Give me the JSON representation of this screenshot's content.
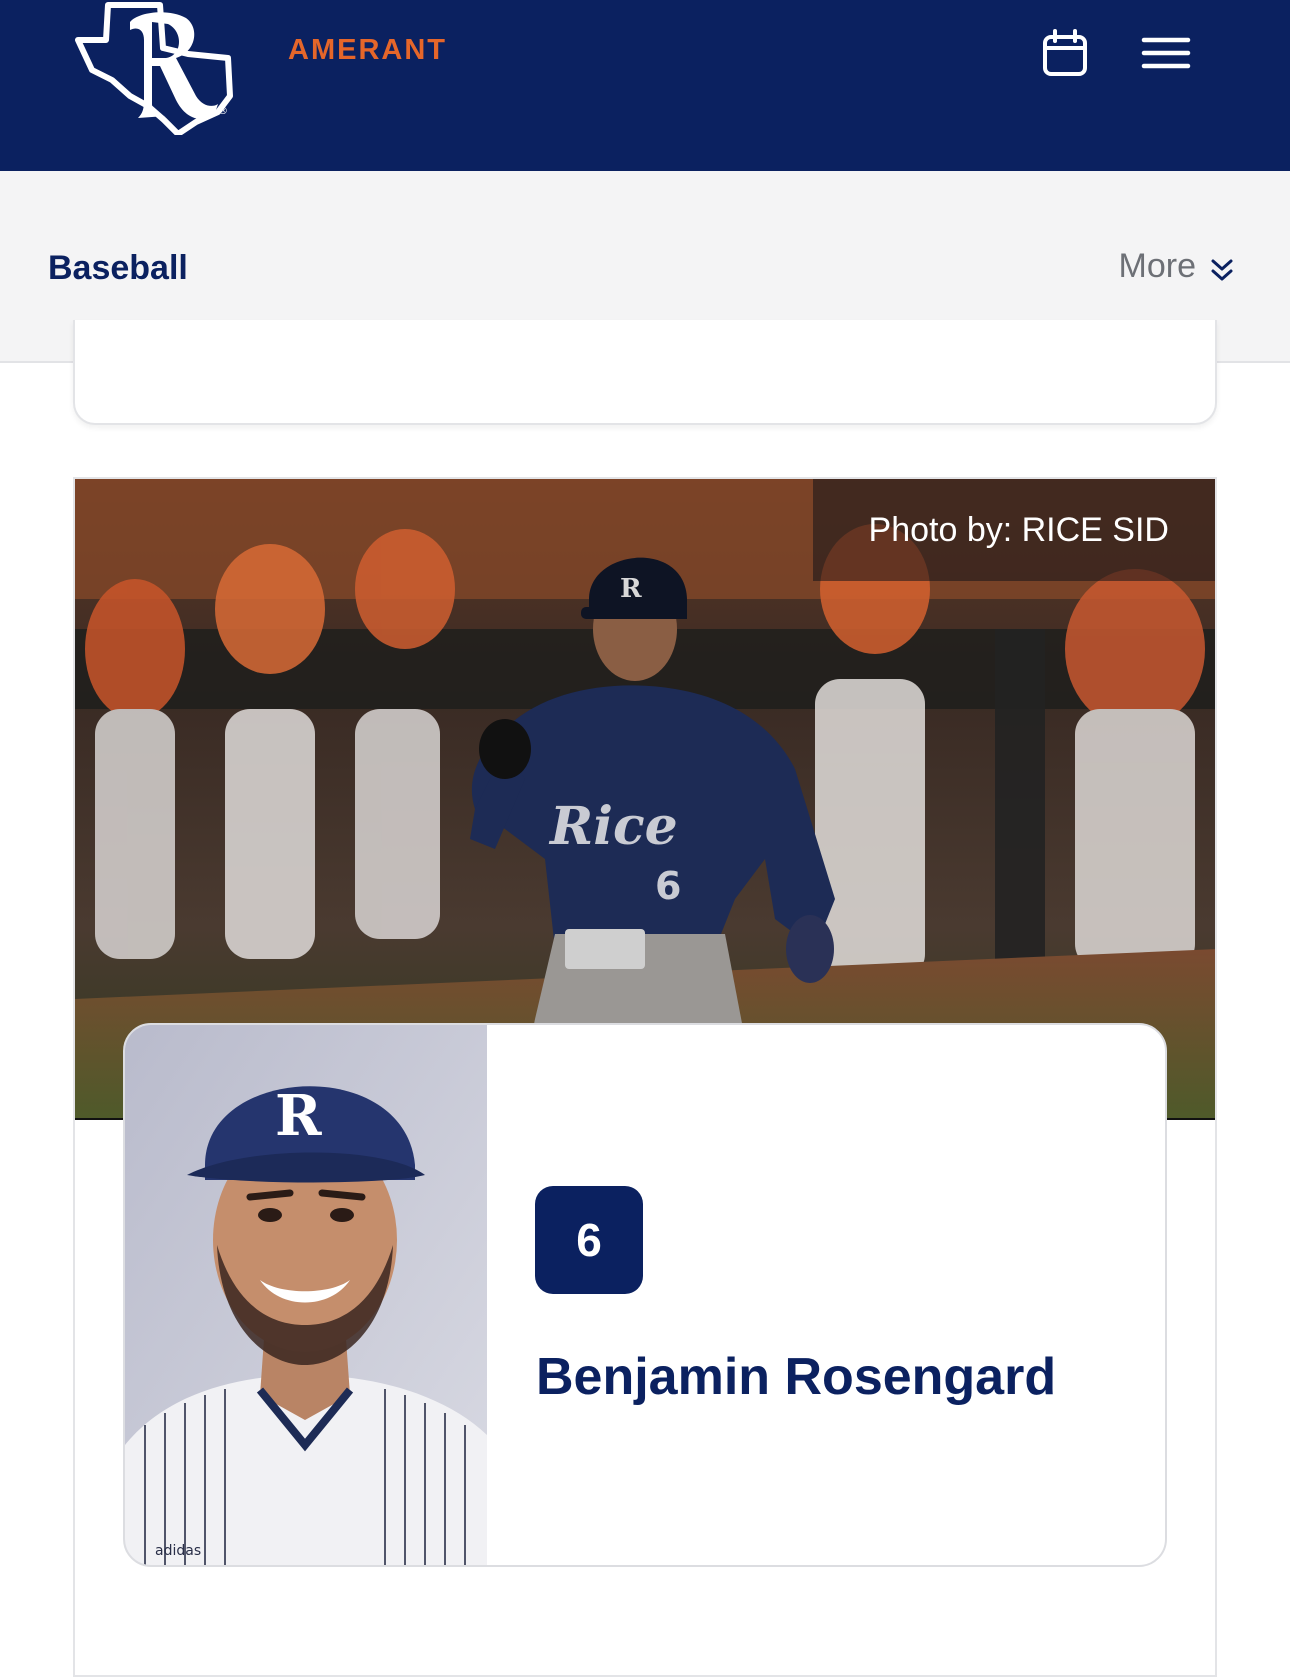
{
  "header": {
    "logo_alt": "Rice Owls R logo",
    "sponsor": "AMERANT",
    "icons": {
      "calendar": "calendar-icon",
      "menu": "hamburger-menu-icon"
    }
  },
  "subnav": {
    "title": "Baseball",
    "more_label": "More",
    "more_icon": "double-chevron-down-icon"
  },
  "feature": {
    "photo_credit": "Photo by: RICE SID",
    "jersey_number_on_photo": "6"
  },
  "player": {
    "number": "6",
    "name": "Benjamin Rosengard"
  },
  "colors": {
    "navy": "#0b2160",
    "orange_accent": "#e5662a",
    "subnav_bg": "#f4f4f5",
    "muted_text": "#6d7076"
  }
}
